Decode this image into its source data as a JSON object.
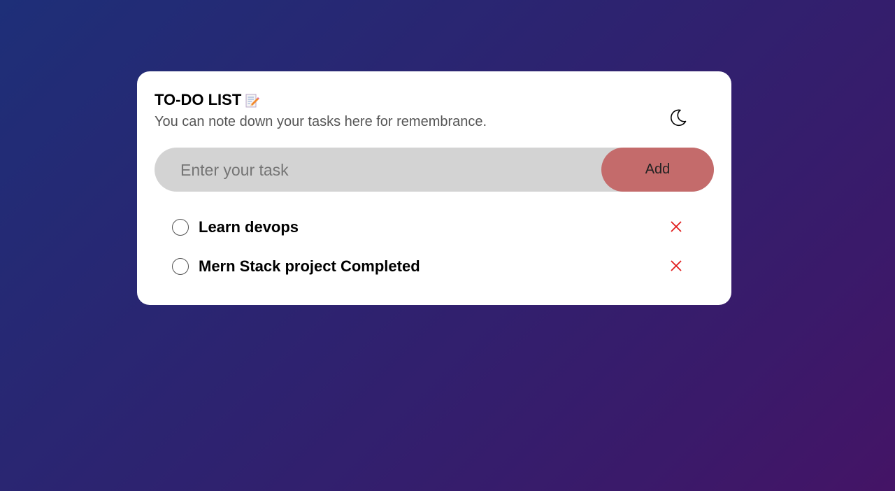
{
  "header": {
    "title": "TO-DO LIST",
    "title_icon": "memo-icon",
    "subtitle": "You can note down your tasks here for remembrance."
  },
  "theme_toggle": {
    "icon": "moon-icon"
  },
  "task_input": {
    "value": "",
    "placeholder": "Enter your task"
  },
  "add_button": {
    "label": "Add",
    "color": "#c46b6b"
  },
  "tasks": [
    {
      "text": "Learn devops",
      "completed": false
    },
    {
      "text": "Mern Stack project Completed",
      "completed": false
    }
  ],
  "colors": {
    "delete": "#e11d1d",
    "input_bg": "#d3d3d3",
    "card_bg": "#ffffff"
  }
}
